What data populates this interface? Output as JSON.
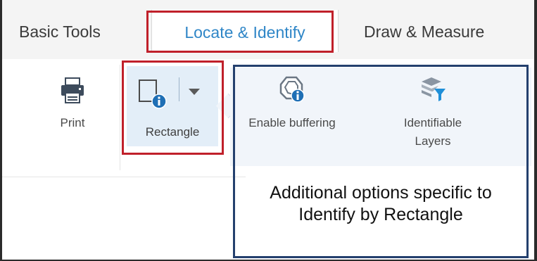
{
  "tabs": {
    "basic_tools": "Basic Tools",
    "locate_identify": "Locate & Identify",
    "draw_measure": "Draw & Measure",
    "active": "Locate & Identify"
  },
  "ribbon": {
    "print_label": "Print",
    "rectangle_label": "Rectangle",
    "buffer_label": "Enable buffering",
    "layers_label_line1": "Identifiable",
    "layers_label_line2": "Layers"
  },
  "callout": {
    "line1": "Additional options specific to",
    "line2": "Identify by Rectangle"
  },
  "colors": {
    "active_tab_text": "#2f86c7",
    "highlight_red": "#c0202a",
    "callout_border": "#24406e",
    "icon_blue": "#1f6fb5"
  },
  "icons": {
    "print": "printer-icon",
    "rectangle": "rectangle-identify-icon",
    "dropdown": "chevron-down-icon",
    "buffer": "buffer-identify-icon",
    "layers": "layers-filter-icon"
  }
}
